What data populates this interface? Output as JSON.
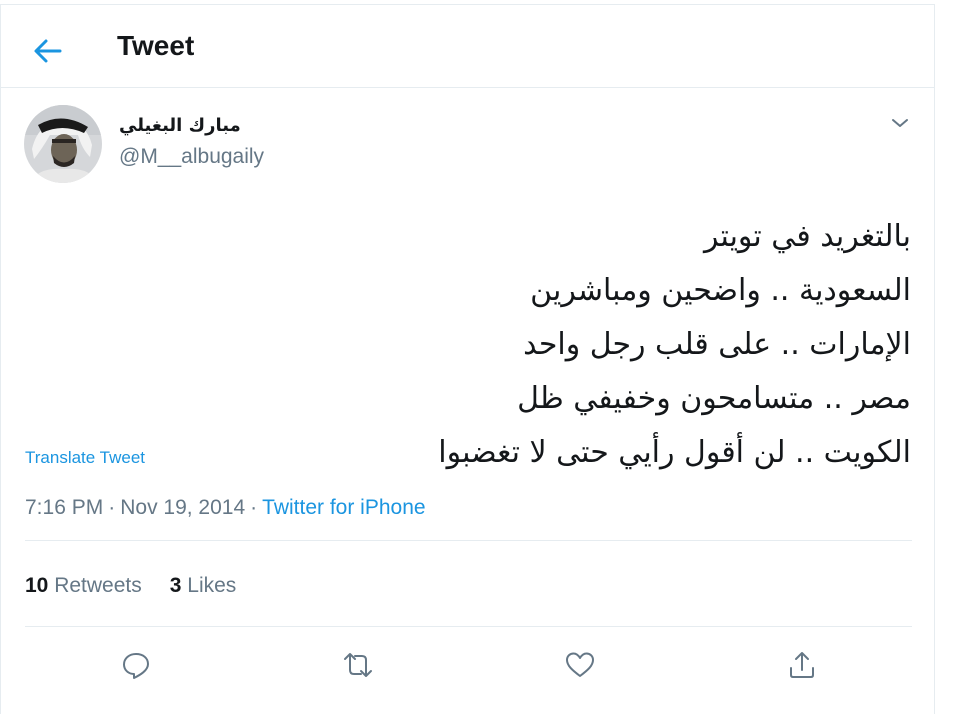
{
  "header": {
    "title": "Tweet",
    "back_icon": "arrow-left-icon"
  },
  "colors": {
    "accent": "#1b95e0",
    "text_primary": "#14171a",
    "text_secondary": "#657786",
    "divider": "#e6ecf0"
  },
  "author": {
    "display_name": "مبارك البغيلي",
    "handle": "@M__albugaily",
    "avatar_icon": "user-avatar",
    "menu_icon": "chevron-down-icon"
  },
  "tweet": {
    "lines": [
      "بالتغريد في تويتر",
      "السعودية .. واضحين ومباشرين",
      "الإمارات .. على قلب رجل واحد",
      "مصر .. متسامحون وخفيفي ظل",
      "الكويت .. لن أقول رأيي حتى لا تغضبوا"
    ],
    "translate_label": "Translate Tweet"
  },
  "meta": {
    "time": "7:16 PM",
    "separator": "·",
    "date": "Nov 19, 2014",
    "source": "Twitter for iPhone"
  },
  "stats": {
    "retweets_count": "10",
    "retweets_label": "Retweets",
    "likes_count": "3",
    "likes_label": "Likes"
  },
  "actions": [
    {
      "icon": "reply-icon"
    },
    {
      "icon": "retweet-icon"
    },
    {
      "icon": "like-icon"
    },
    {
      "icon": "share-icon"
    }
  ]
}
